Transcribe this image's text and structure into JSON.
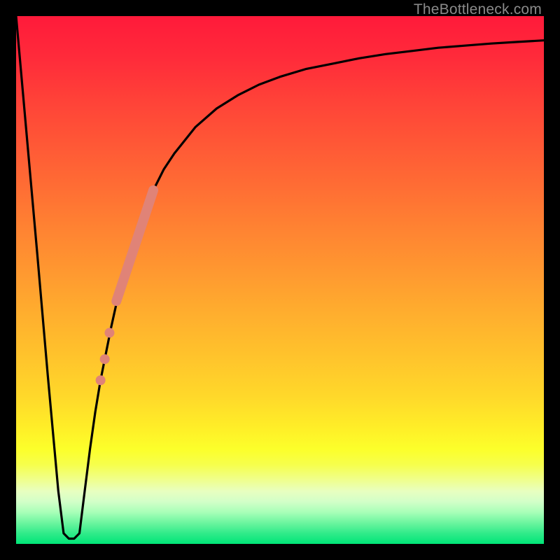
{
  "watermark": "TheBottleneck.com",
  "colors": {
    "frame": "#000000",
    "curve": "#000000",
    "marker": "#e08377",
    "gradient_top": "#ff1a3a",
    "gradient_bottom": "#00e577"
  },
  "chart_data": {
    "type": "line",
    "title": "",
    "xlabel": "",
    "ylabel": "",
    "xlim": [
      0,
      100
    ],
    "ylim": [
      0,
      100
    ],
    "series": [
      {
        "name": "bottleneck-curve",
        "x": [
          0,
          4,
          6,
          8,
          9,
          10,
          11,
          12,
          13,
          14,
          15,
          16,
          18,
          20,
          22,
          24,
          26,
          28,
          30,
          34,
          38,
          42,
          46,
          50,
          55,
          60,
          65,
          70,
          75,
          80,
          85,
          90,
          95,
          100
        ],
        "y": [
          100,
          55,
          32,
          10,
          2,
          1,
          1,
          2,
          10,
          18,
          25,
          31,
          41,
          50,
          57,
          62,
          67,
          71,
          74,
          79,
          82.5,
          85,
          87,
          88.5,
          90,
          91,
          92,
          92.8,
          93.4,
          94,
          94.4,
          94.8,
          95.1,
          95.4
        ]
      },
      {
        "name": "highlight-segment",
        "x": [
          19,
          26
        ],
        "y": [
          46,
          67
        ]
      }
    ],
    "markers": [
      {
        "x": 16.0,
        "y": 31
      },
      {
        "x": 16.8,
        "y": 35
      },
      {
        "x": 17.7,
        "y": 40
      }
    ]
  }
}
